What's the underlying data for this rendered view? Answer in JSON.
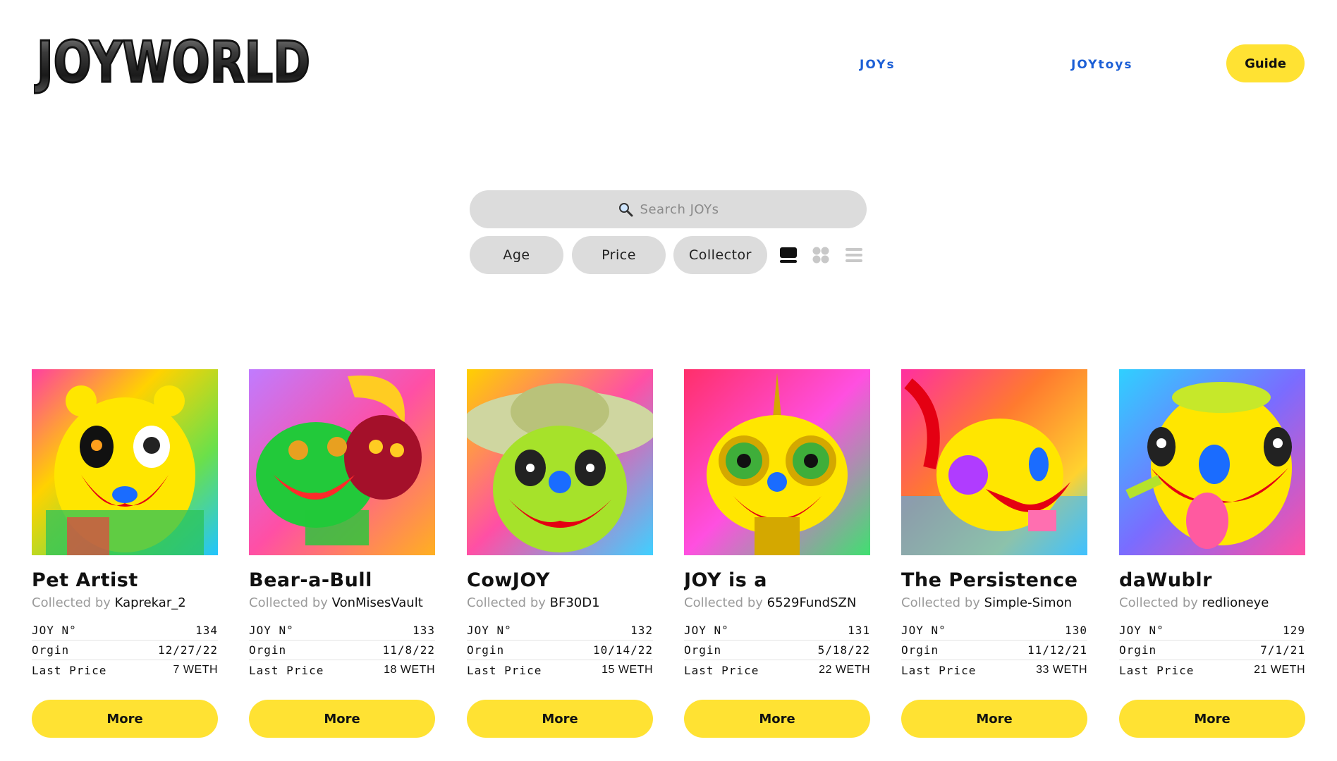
{
  "header": {
    "logo_text": "JOYWORLD",
    "nav": [
      {
        "label": "JOYs"
      },
      {
        "label": "JOYtoys"
      }
    ],
    "guide_label": "Guide"
  },
  "search": {
    "placeholder": "Search JOYs",
    "icon": "search-icon"
  },
  "filters": [
    {
      "label": "Age"
    },
    {
      "label": "Price"
    },
    {
      "label": "Collector"
    }
  ],
  "view_modes": [
    "large-view-icon",
    "grid-view-icon",
    "list-view-icon"
  ],
  "stat_labels": {
    "number": "JOY N°",
    "origin": "Orgin",
    "price": "Last Price"
  },
  "collected_prefix": "Collected by",
  "more_label": "More",
  "colors": {
    "accent_yellow": "#ffe233",
    "link_blue": "#1c5fd6",
    "pill_gray": "#dcdcdc"
  },
  "cards": [
    {
      "name": "Pet Artist",
      "collector": "Kaprekar_2",
      "number": "134",
      "origin": "12/27/22",
      "price": "7 WETH"
    },
    {
      "name": "Bear-a-Bull",
      "collector": "VonMisesVault",
      "number": "133",
      "origin": "11/8/22",
      "price": "18 WETH"
    },
    {
      "name": "CowJOY",
      "collector": "BF30D1",
      "number": "132",
      "origin": "10/14/22",
      "price": "15 WETH"
    },
    {
      "name": "JOY is a",
      "collector": "6529FundSZN",
      "number": "131",
      "origin": "5/18/22",
      "price": "22 WETH"
    },
    {
      "name": "The Persistence",
      "collector": "Simple-Simon",
      "number": "130",
      "origin": "11/12/21",
      "price": "33 WETH"
    },
    {
      "name": "daWublr",
      "collector": "redlioneye",
      "number": "129",
      "origin": "7/1/21",
      "price": "21 WETH"
    }
  ]
}
